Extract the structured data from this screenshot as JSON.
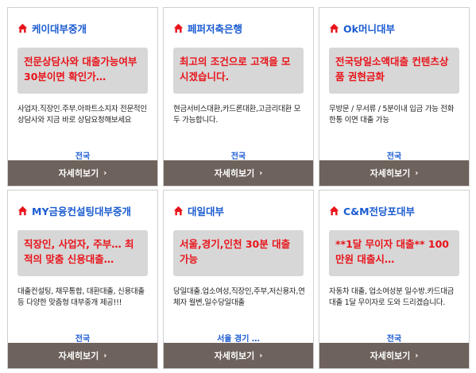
{
  "colors": {
    "title": "#1a5bd1",
    "headline": "#e8141b",
    "button_bg": "#6e625c",
    "headline_bg": "#d7d7d7",
    "icon": "#e8141b"
  },
  "icons": {
    "title": "home-icon",
    "button": "chevron-right-icon"
  },
  "cards": [
    {
      "name": "케이대부중개",
      "headline": "전문상담사와 대출가능여부 30분이면 확인가…",
      "description": "사업자.직장인.주부.아파트소지자 전문적인 상담사와 지금 바로 상담요청해보세요",
      "region": "전국",
      "button": "자세히보기",
      "chevron": "›"
    },
    {
      "name": "페퍼저축은행",
      "headline": "최고의 조건으로 고객을 모시겠습니다.",
      "description": "현금서비스대환,카드론대환,고금리대환 모두 가능합니다.",
      "region": "전국",
      "button": "자세히보기",
      "chevron": "›"
    },
    {
      "name": "Ok머니대부",
      "headline": "전국당일소액대출 컨텐츠상품 권현금화",
      "description": "무방문 / 무서류 / 5분이내 입금 가능 전화 한통 이면 대출 가능",
      "region": "전국",
      "button": "자세히보기",
      "chevron": "›"
    },
    {
      "name": "MY금융컨설팅대부중개",
      "headline": "직장인, 사업자, 주부… 최적의 맞춤 신용대출…",
      "description": "대출컨설팅, 채무통합, 대환대출, 신용대출 등 다양한 맞춤형 대부중개 제공!!!",
      "region": "전국",
      "button": "자세히보기",
      "chevron": "›"
    },
    {
      "name": "대일대부",
      "headline": "서울,경기,인천 30분 대출가능",
      "description": "당일대출.업소여성,직장인,주부,저신용자,연체자 월변,일수당일대출",
      "region": "서울 경기 …",
      "button": "자세히보기",
      "chevron": "›"
    },
    {
      "name": "C&M전당포대부",
      "headline": "**1달 무이자 대출** 100만원 대출시…",
      "description": "자동차 대출, 업소여성분 일수방.카드대금 대출 1달 무이자로 도와 드리겠습니다.",
      "region": "전국",
      "button": "자세히보기",
      "chevron": "›"
    }
  ]
}
